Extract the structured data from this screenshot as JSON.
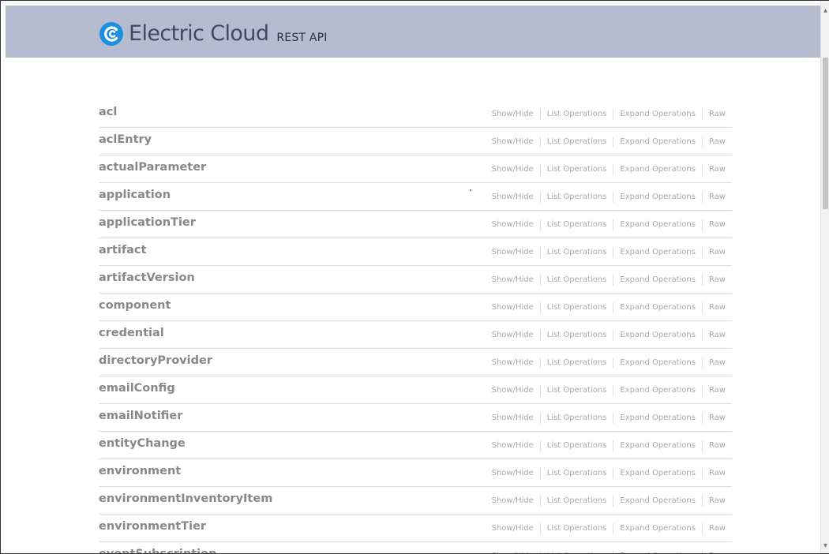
{
  "header": {
    "brand": "Electric Cloud",
    "subtitle": "REST API",
    "logo_icon": "electric-cloud-logo-icon",
    "background": "#b6bcd0"
  },
  "actions": {
    "show_hide": "Show/Hide",
    "list_operations": "List Operations",
    "expand_operations": "Expand Operations",
    "raw": "Raw"
  },
  "resources": [
    {
      "name": "acl"
    },
    {
      "name": "aclEntry"
    },
    {
      "name": "actualParameter"
    },
    {
      "name": "application"
    },
    {
      "name": "applicationTier"
    },
    {
      "name": "artifact"
    },
    {
      "name": "artifactVersion"
    },
    {
      "name": "component"
    },
    {
      "name": "credential"
    },
    {
      "name": "directoryProvider"
    },
    {
      "name": "emailConfig"
    },
    {
      "name": "emailNotifier"
    },
    {
      "name": "entityChange"
    },
    {
      "name": "environment"
    },
    {
      "name": "environmentInventoryItem"
    },
    {
      "name": "environmentTier"
    },
    {
      "name": "eventSubscription"
    }
  ],
  "scrollbar": {
    "up_icon": "scroll-up-arrow-icon",
    "down_icon": "scroll-down-arrow-icon"
  }
}
